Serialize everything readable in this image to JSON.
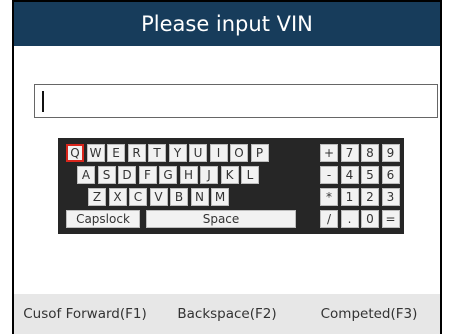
{
  "header": {
    "title": "Please input VIN"
  },
  "vin_input": {
    "value": ""
  },
  "keyboard": {
    "row1": [
      "Q",
      "W",
      "E",
      "R",
      "T",
      "Y",
      "U",
      "I",
      "O",
      "P"
    ],
    "row2": [
      "A",
      "S",
      "D",
      "F",
      "G",
      "H",
      "J",
      "K",
      "L"
    ],
    "row3": [
      "Z",
      "X",
      "C",
      "V",
      "B",
      "N",
      "M"
    ],
    "capslock_label": "Capslock",
    "space_label": "Space",
    "keypad": [
      [
        "+",
        "7",
        "8",
        "9"
      ],
      [
        "-",
        "4",
        "5",
        "6"
      ],
      [
        "*",
        "1",
        "2",
        "3"
      ],
      [
        "/",
        ".",
        "0",
        "="
      ]
    ],
    "selected_key": "Q"
  },
  "function_bar": {
    "f1_label": "Cusof Forward(F1)",
    "f2_label": "Backspace(F2)",
    "f3_label": "Competed(F3)"
  },
  "colors": {
    "title_bar": "#173c5b",
    "keyboard_bg": "#262626",
    "selected_border": "#d9261c",
    "function_bar": "#e7e7e7"
  }
}
